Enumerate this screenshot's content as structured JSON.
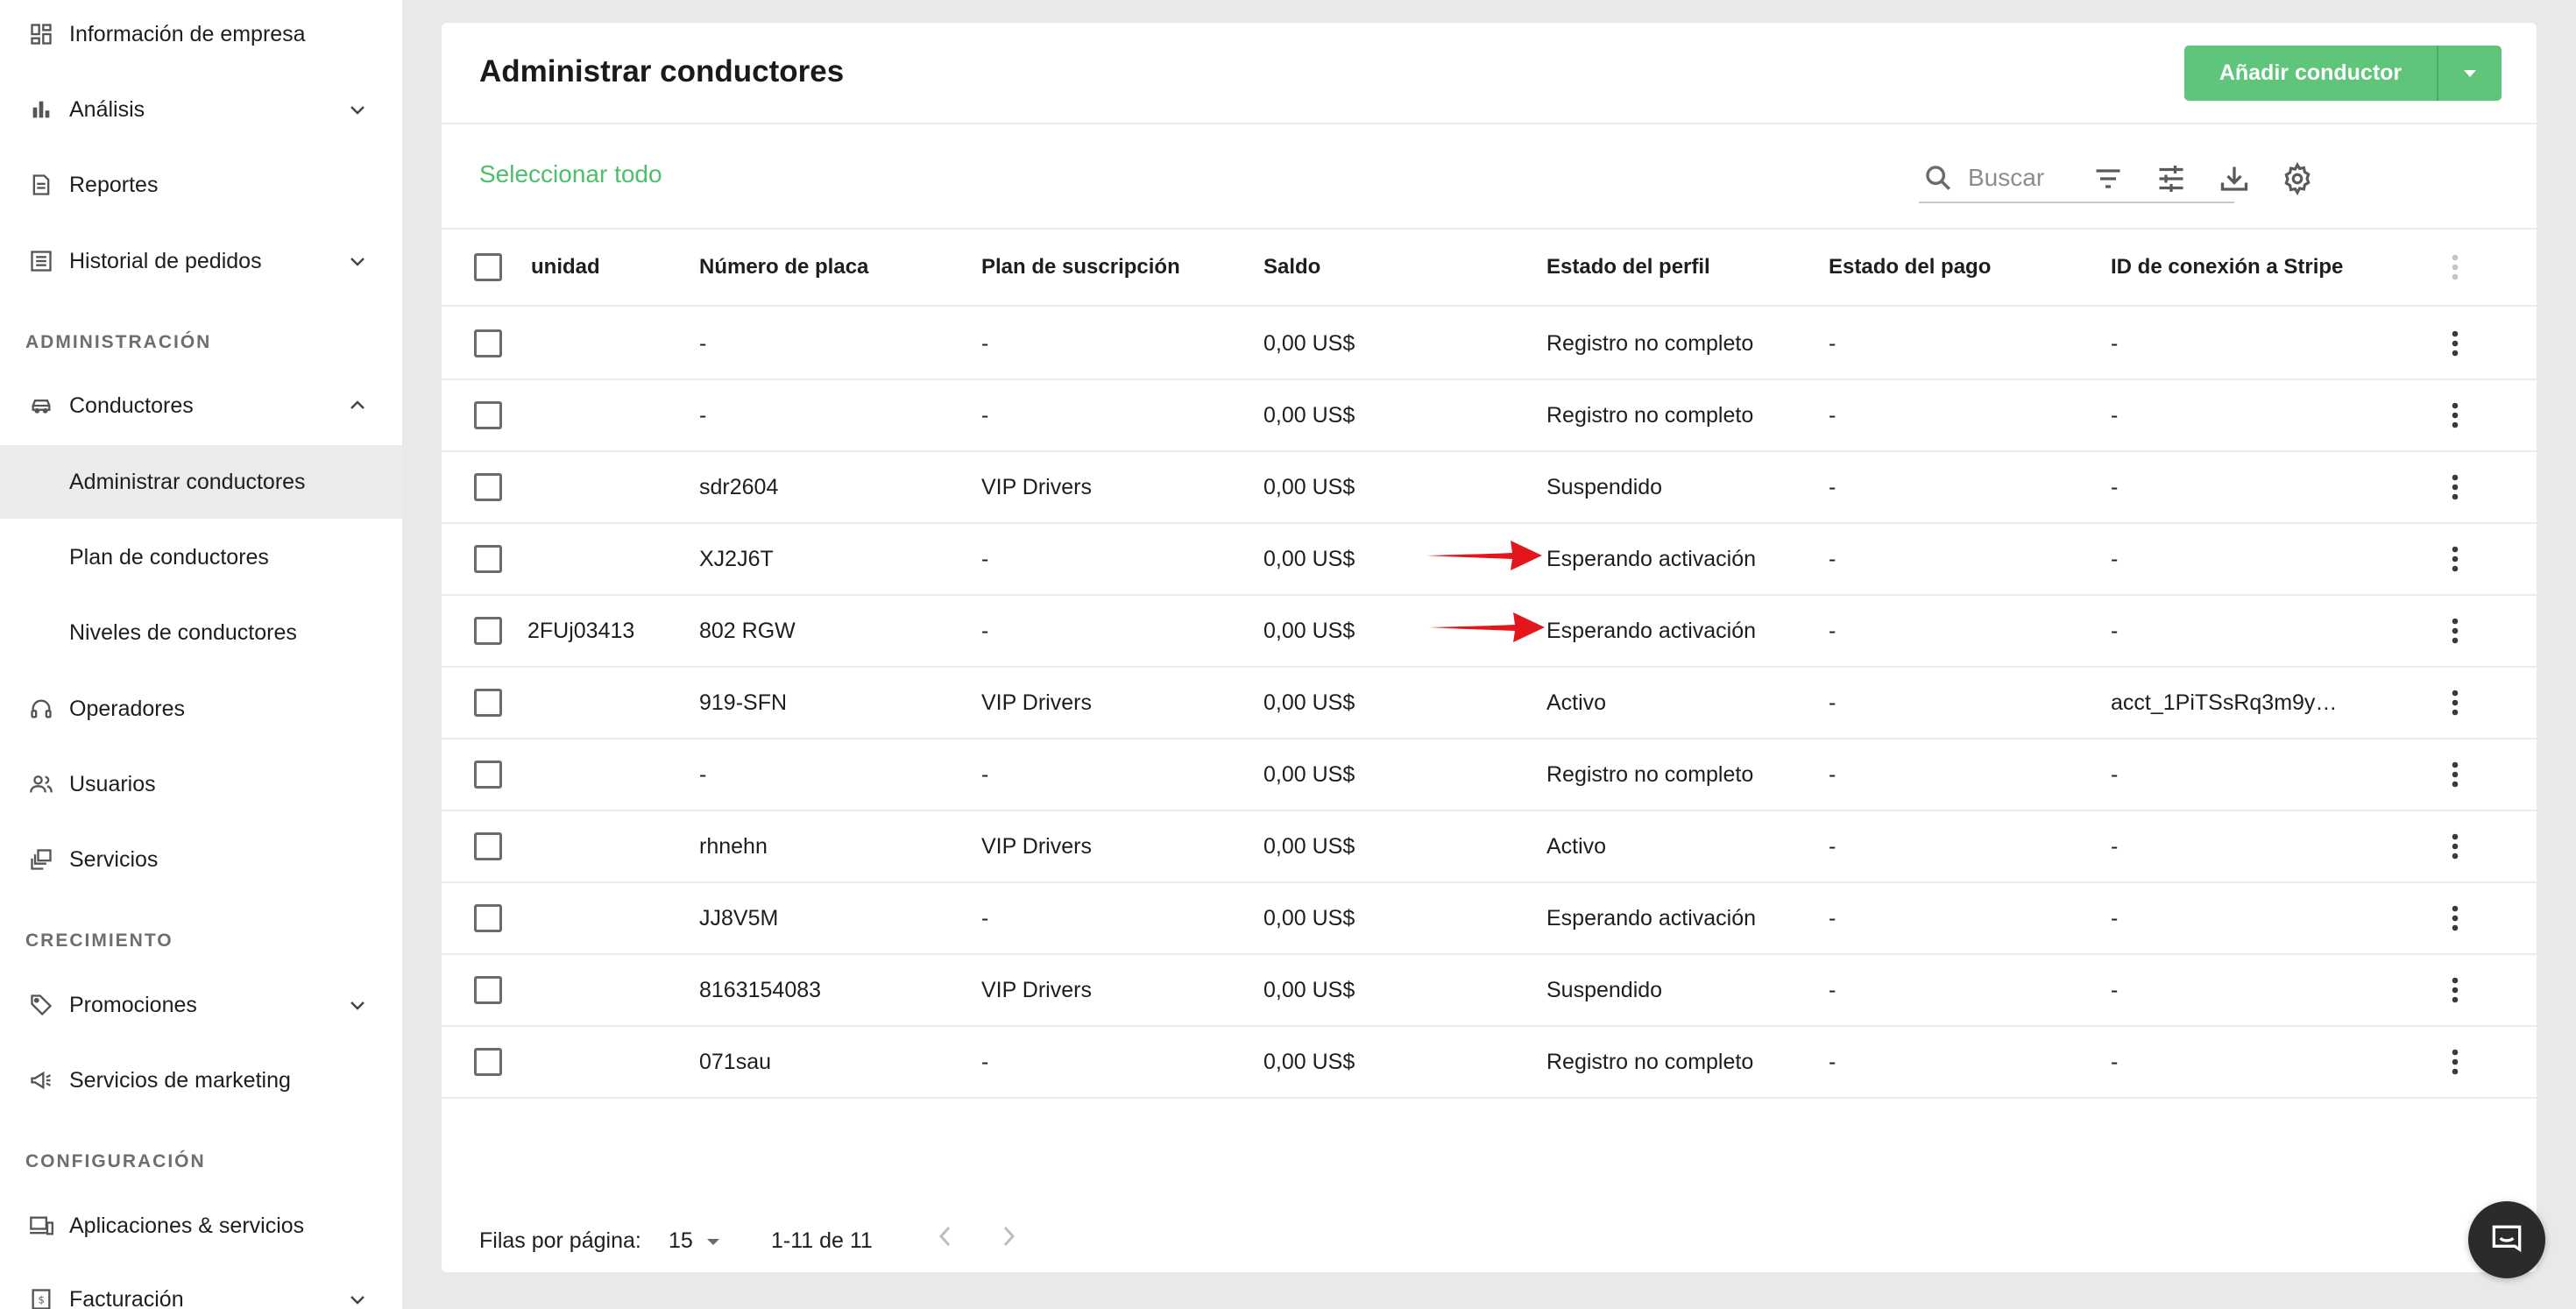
{
  "sidebar": {
    "company_info": "Información de empresa",
    "analysis": "Análisis",
    "reports": "Reportes",
    "order_history": "Historial de pedidos",
    "section_admin": "ADMINISTRACIÓN",
    "drivers": "Conductores",
    "manage_drivers": "Administrar conductores",
    "drivers_plan": "Plan de conductores",
    "drivers_levels": "Niveles de conductores",
    "operators": "Operadores",
    "users": "Usuarios",
    "services": "Servicios",
    "section_growth": "CRECIMIENTO",
    "promotions": "Promociones",
    "marketing": "Servicios de marketing",
    "section_config": "CONFIGURACIÓN",
    "apps": "Aplicaciones & servicios",
    "billing": "Facturación"
  },
  "header": {
    "title": "Administrar conductores",
    "add_button": "Añadir conductor"
  },
  "toolbar": {
    "select_all": "Seleccionar todo",
    "search_placeholder": "Buscar"
  },
  "table": {
    "columns": {
      "unit": "unidad",
      "plate": "Número de placa",
      "plan": "Plan de suscripción",
      "balance": "Saldo",
      "profile_status": "Estado del perfil",
      "payment_status": "Estado del pago",
      "stripe_id": "ID de conexión a Stripe"
    },
    "rows": [
      {
        "unit": "",
        "plate": "-",
        "plan": "-",
        "balance": "0,00 US$",
        "profile_status": "Registro no completo",
        "payment_status": "-",
        "stripe_id": "-"
      },
      {
        "unit": "",
        "plate": "-",
        "plan": "-",
        "balance": "0,00 US$",
        "profile_status": "Registro no completo",
        "payment_status": "-",
        "stripe_id": "-"
      },
      {
        "unit": "",
        "plate": "sdr2604",
        "plan": "VIP Drivers",
        "balance": "0,00 US$",
        "profile_status": "Suspendido",
        "payment_status": "-",
        "stripe_id": "-"
      },
      {
        "unit": "",
        "plate": "XJ2J6T",
        "plan": "-",
        "balance": "0,00 US$",
        "profile_status": "Esperando activación",
        "payment_status": "-",
        "stripe_id": "-"
      },
      {
        "unit": "2FUj03413",
        "plate": "802 RGW",
        "plan": "-",
        "balance": "0,00 US$",
        "profile_status": "Esperando activación",
        "payment_status": "-",
        "stripe_id": "-"
      },
      {
        "unit": "",
        "plate": "919-SFN",
        "plan": "VIP Drivers",
        "balance": "0,00 US$",
        "profile_status": "Activo",
        "payment_status": "-",
        "stripe_id": "acct_1PiTSsRq3m9y…"
      },
      {
        "unit": "",
        "plate": "-",
        "plan": "-",
        "balance": "0,00 US$",
        "profile_status": "Registro no completo",
        "payment_status": "-",
        "stripe_id": "-"
      },
      {
        "unit": "",
        "plate": "rhnehn",
        "plan": "VIP Drivers",
        "balance": "0,00 US$",
        "profile_status": "Activo",
        "payment_status": "-",
        "stripe_id": "-"
      },
      {
        "unit": "",
        "plate": "JJ8V5M",
        "plan": "-",
        "balance": "0,00 US$",
        "profile_status": "Esperando activación",
        "payment_status": "-",
        "stripe_id": "-"
      },
      {
        "unit": "",
        "plate": "8163154083",
        "plan": "VIP Drivers",
        "balance": "0,00 US$",
        "profile_status": "Suspendido",
        "payment_status": "-",
        "stripe_id": "-"
      },
      {
        "unit": "",
        "plate": "071sau",
        "plan": "-",
        "balance": "0,00 US$",
        "profile_status": "Registro no completo",
        "payment_status": "-",
        "stripe_id": "-"
      }
    ]
  },
  "footer": {
    "rows_per_page_label": "Filas por página:",
    "rows_per_page": "15",
    "range": "1-11 de 11"
  },
  "colors": {
    "accent_green": "#5ec57a",
    "link_green": "#4cbf6a",
    "annotation_red": "#e3171b"
  }
}
